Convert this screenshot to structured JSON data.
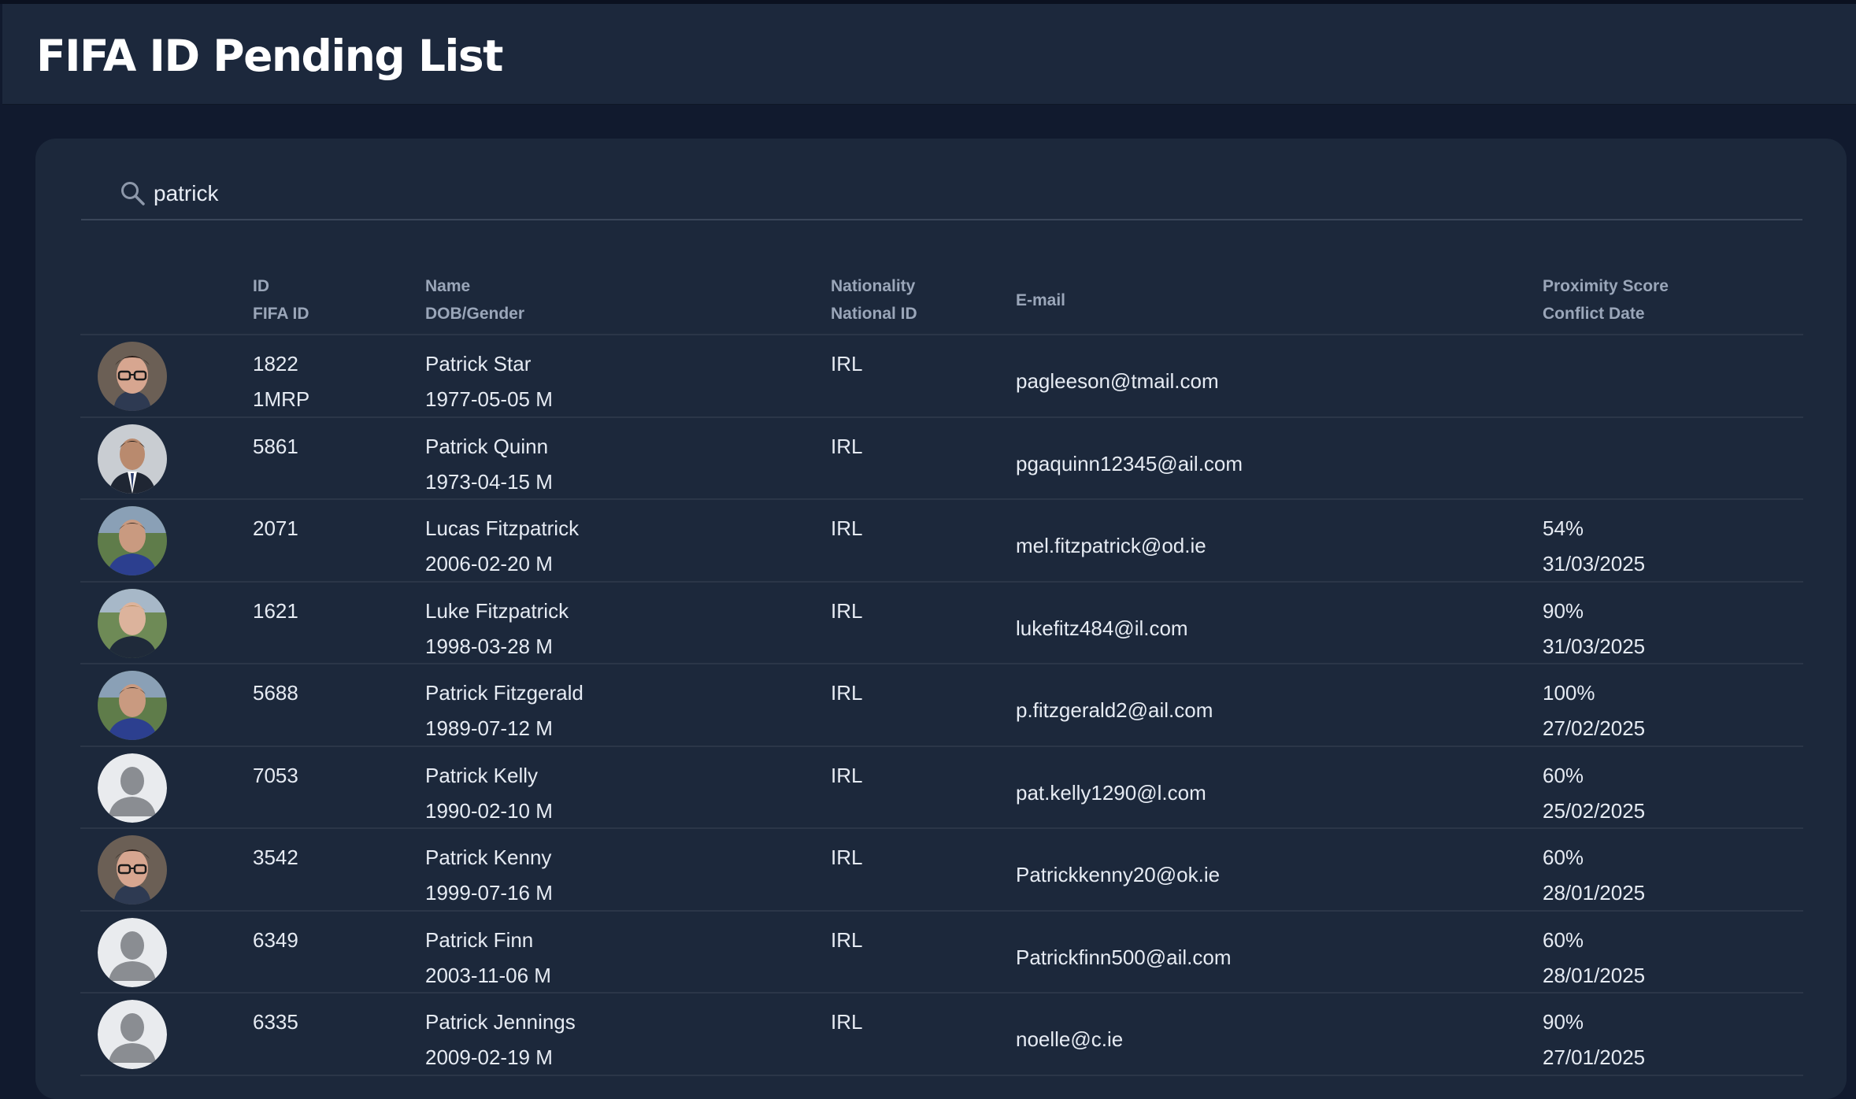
{
  "page": {
    "title": "FIFA ID Pending List"
  },
  "search": {
    "value": "patrick",
    "icon": "search-icon"
  },
  "columns": {
    "id": [
      "ID",
      "FIFA ID"
    ],
    "name": [
      "Name",
      "DOB/Gender"
    ],
    "nationality": [
      "Nationality",
      "National ID"
    ],
    "email": "E-mail",
    "proximity": [
      "Proximity Score",
      "Conflict Date"
    ]
  },
  "rows": [
    {
      "id": "1822",
      "fifa_id": "1MRP",
      "name": "Patrick Star",
      "dob": "1977-05-05 M",
      "nationality": "IRL",
      "email": "pagleeson@tmail.com",
      "score": "",
      "date": "",
      "avatar": "glasses-man"
    },
    {
      "id": "5861",
      "fifa_id": "",
      "name": "Patrick Quinn",
      "dob": "1973-04-15 M",
      "nationality": "IRL",
      "email": "pgaquinn12345@ail.com",
      "score": "",
      "date": "",
      "avatar": "suit-man"
    },
    {
      "id": "2071",
      "fifa_id": "",
      "name": "Lucas Fitzpatrick",
      "dob": "2006-02-20 M",
      "nationality": "IRL",
      "email": "mel.fitzpatrick@od.ie",
      "score": "54%",
      "date": "31/03/2025",
      "avatar": "player-blue"
    },
    {
      "id": "1621",
      "fifa_id": "",
      "name": "Luke Fitzpatrick",
      "dob": "1998-03-28 M",
      "nationality": "IRL",
      "email": "lukefitz484@il.com",
      "score": "90%",
      "date": "31/03/2025",
      "avatar": "player-dark"
    },
    {
      "id": "5688",
      "fifa_id": "",
      "name": "Patrick Fitzgerald",
      "dob": "1989-07-12 M",
      "nationality": "IRL",
      "email": "p.fitzgerald2@ail.com",
      "score": "100%",
      "date": "27/02/2025",
      "avatar": "player-blue"
    },
    {
      "id": "7053",
      "fifa_id": "",
      "name": "Patrick Kelly",
      "dob": "1990-02-10 M",
      "nationality": "IRL",
      "email": "pat.kelly1290@l.com",
      "score": "60%",
      "date": "25/02/2025",
      "avatar": "placeholder"
    },
    {
      "id": "3542",
      "fifa_id": "",
      "name": "Patrick Kenny",
      "dob": "1999-07-16 M",
      "nationality": "IRL",
      "email": "Patrickkenny20@ok.ie",
      "score": "60%",
      "date": "28/01/2025",
      "avatar": "glasses-man"
    },
    {
      "id": "6349",
      "fifa_id": "",
      "name": "Patrick Finn",
      "dob": "2003-11-06 M",
      "nationality": "IRL",
      "email": "Patrickfinn500@ail.com",
      "score": "60%",
      "date": "28/01/2025",
      "avatar": "placeholder"
    },
    {
      "id": "6335",
      "fifa_id": "",
      "name": "Patrick Jennings",
      "dob": "2009-02-19 M",
      "nationality": "IRL",
      "email": "noelle@c.ie",
      "score": "90%",
      "date": "27/01/2025",
      "avatar": "placeholder"
    }
  ],
  "colors": {
    "background": "#111a2e",
    "header": "#1c283c",
    "card": "#1c283b",
    "text": "#e6ebf3",
    "muted": "#9aa6b9"
  }
}
